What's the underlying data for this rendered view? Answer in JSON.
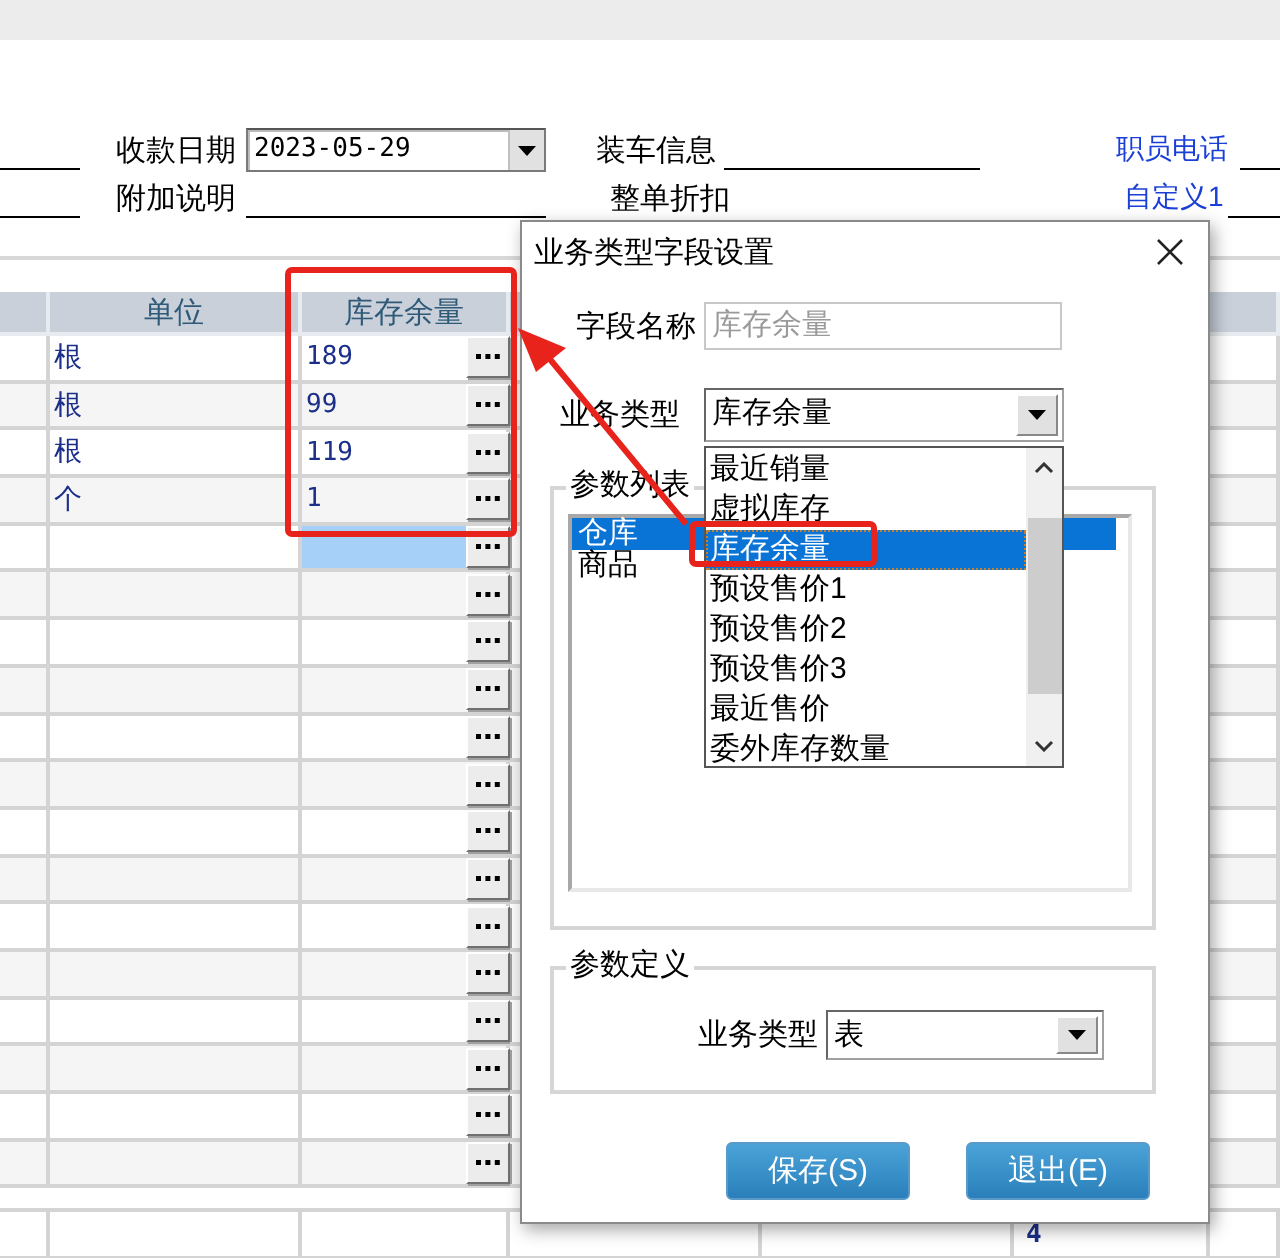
{
  "form_rows": [
    [
      {
        "kind": "line"
      },
      {
        "kind": "label",
        "text": "收款日期"
      },
      {
        "kind": "combo",
        "value": "2023-05-29"
      },
      {
        "kind": "label",
        "text": "装车信息"
      },
      {
        "kind": "line"
      },
      {
        "kind": "link",
        "text": "职员电话"
      },
      {
        "kind": "line"
      }
    ],
    [
      {
        "kind": "line"
      },
      {
        "kind": "label",
        "text": "附加说明"
      },
      {
        "kind": "line"
      },
      {
        "kind": "label",
        "text": "整单折扣"
      },
      {
        "kind": "link",
        "text": "自定义1"
      },
      {
        "kind": "line"
      }
    ]
  ],
  "table": {
    "columns": [
      "单位",
      "库存余量"
    ],
    "rows": [
      {
        "unit": "根",
        "stock": "189",
        "selected": false
      },
      {
        "unit": "根",
        "stock": "99",
        "selected": false
      },
      {
        "unit": "根",
        "stock": "119",
        "selected": false
      },
      {
        "unit": "个",
        "stock": "1",
        "selected": false
      },
      {
        "selected": true
      },
      {
        "selected": false
      },
      {
        "selected": false
      },
      {
        "selected": false
      },
      {
        "selected": false
      },
      {
        "selected": false
      },
      {
        "selected": false
      },
      {
        "selected": false
      },
      {
        "selected": false
      },
      {
        "selected": false
      },
      {
        "selected": false
      },
      {
        "selected": false
      },
      {
        "selected": false
      },
      {
        "selected": false
      }
    ],
    "footer_count": "4"
  },
  "dialog": {
    "title": "业务类型字段设置",
    "field_name": {
      "label": "字段名称",
      "value": "库存余量",
      "disabled": true
    },
    "business_type": {
      "label": "业务类型",
      "value": "库存余量",
      "expanded": true,
      "options": [
        {
          "text": "最近销量",
          "selected": false
        },
        {
          "text": "虚拟库存",
          "selected": false
        },
        {
          "text": "库存余量",
          "selected": true
        },
        {
          "text": "预设售价1",
          "selected": false
        },
        {
          "text": "预设售价2",
          "selected": false
        },
        {
          "text": "预设售价3",
          "selected": false
        },
        {
          "text": "最近售价",
          "selected": false
        },
        {
          "text": "委外库存数量",
          "selected": false
        }
      ]
    },
    "param_list": {
      "title": "参数列表",
      "items": [
        {
          "text": "仓库",
          "selected": true
        },
        {
          "text": "商品",
          "selected": false
        }
      ]
    },
    "param_def": {
      "title": "参数定义",
      "label": "业务类型",
      "value": "表"
    },
    "buttons": [
      {
        "label": "保存(S)"
      },
      {
        "label": "退出(E)"
      }
    ]
  },
  "annotations": [
    {
      "kind": "frame"
    },
    {
      "kind": "frame"
    },
    {
      "kind": "arrow"
    }
  ]
}
